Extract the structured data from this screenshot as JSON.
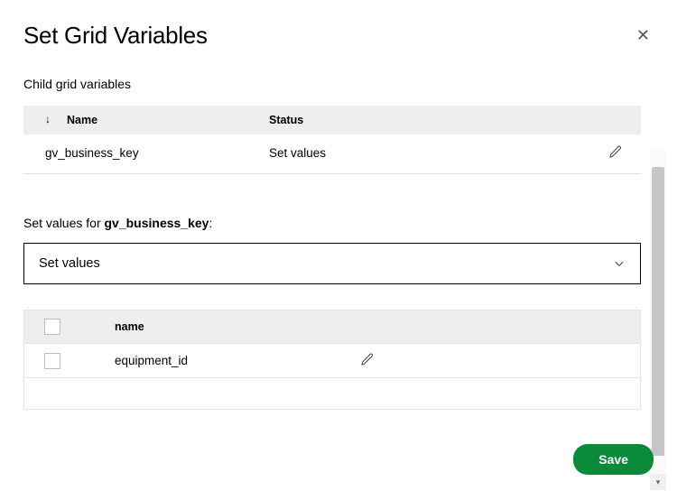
{
  "dialog": {
    "title": "Set Grid Variables",
    "section_label": "Child grid variables",
    "save_label": "Save"
  },
  "grid_vars_table": {
    "headers": {
      "name": "Name",
      "status": "Status"
    },
    "rows": [
      {
        "name": "gv_business_key",
        "status": "Set values"
      }
    ]
  },
  "set_values": {
    "prefix": "Set values for ",
    "variable": "gv_business_key",
    "suffix": ":",
    "dropdown_selected": "Set values"
  },
  "vals_table": {
    "headers": {
      "name": "name"
    },
    "rows": [
      {
        "name": "equipment_id"
      }
    ]
  }
}
